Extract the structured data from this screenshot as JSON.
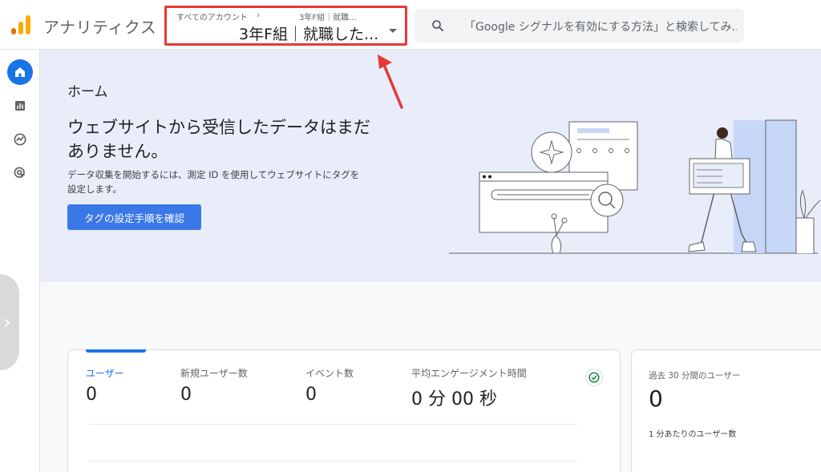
{
  "header": {
    "app_title": "アナリティクス",
    "account_picker": {
      "breadcrumb_account": "すべてのアカウント",
      "breadcrumb_property": "3年F組｜就職...",
      "property_name": "3年F組｜就職した..."
    },
    "search": {
      "placeholder": "「Google シグナルを有効にする方法」と検索してみ..."
    }
  },
  "sidebar": {
    "items": [
      {
        "icon": "home-icon",
        "active": true
      },
      {
        "icon": "reports-icon",
        "active": false
      },
      {
        "icon": "explore-icon",
        "active": false
      },
      {
        "icon": "advertising-icon",
        "active": false
      }
    ]
  },
  "hero": {
    "title": "ホーム",
    "heading": "ウェブサイトから受信したデータはまだありません。",
    "description": "データ収集を開始するには、測定 ID を使用してウェブサイトにタグを設定します。",
    "cta_label": "タグの設定手順を確認"
  },
  "metrics": [
    {
      "label": "ユーザー",
      "value": "0",
      "active": true
    },
    {
      "label": "新規ユーザー数",
      "value": "0",
      "active": false
    },
    {
      "label": "イベント数",
      "value": "0",
      "active": false
    },
    {
      "label": "平均エンゲージメント時間",
      "value": "0 分 00 秒",
      "active": false
    }
  ],
  "realtime": {
    "label": "過去 30 分間のユーザー",
    "value": "0",
    "sublabel": "1 分あたりのユーザー数"
  },
  "colors": {
    "accent": "#1a73e8",
    "highlight_border": "#e53935",
    "hero_bg": "#e8edf9",
    "logo_orange": "#f9ab00",
    "logo_dark": "#e37400"
  }
}
